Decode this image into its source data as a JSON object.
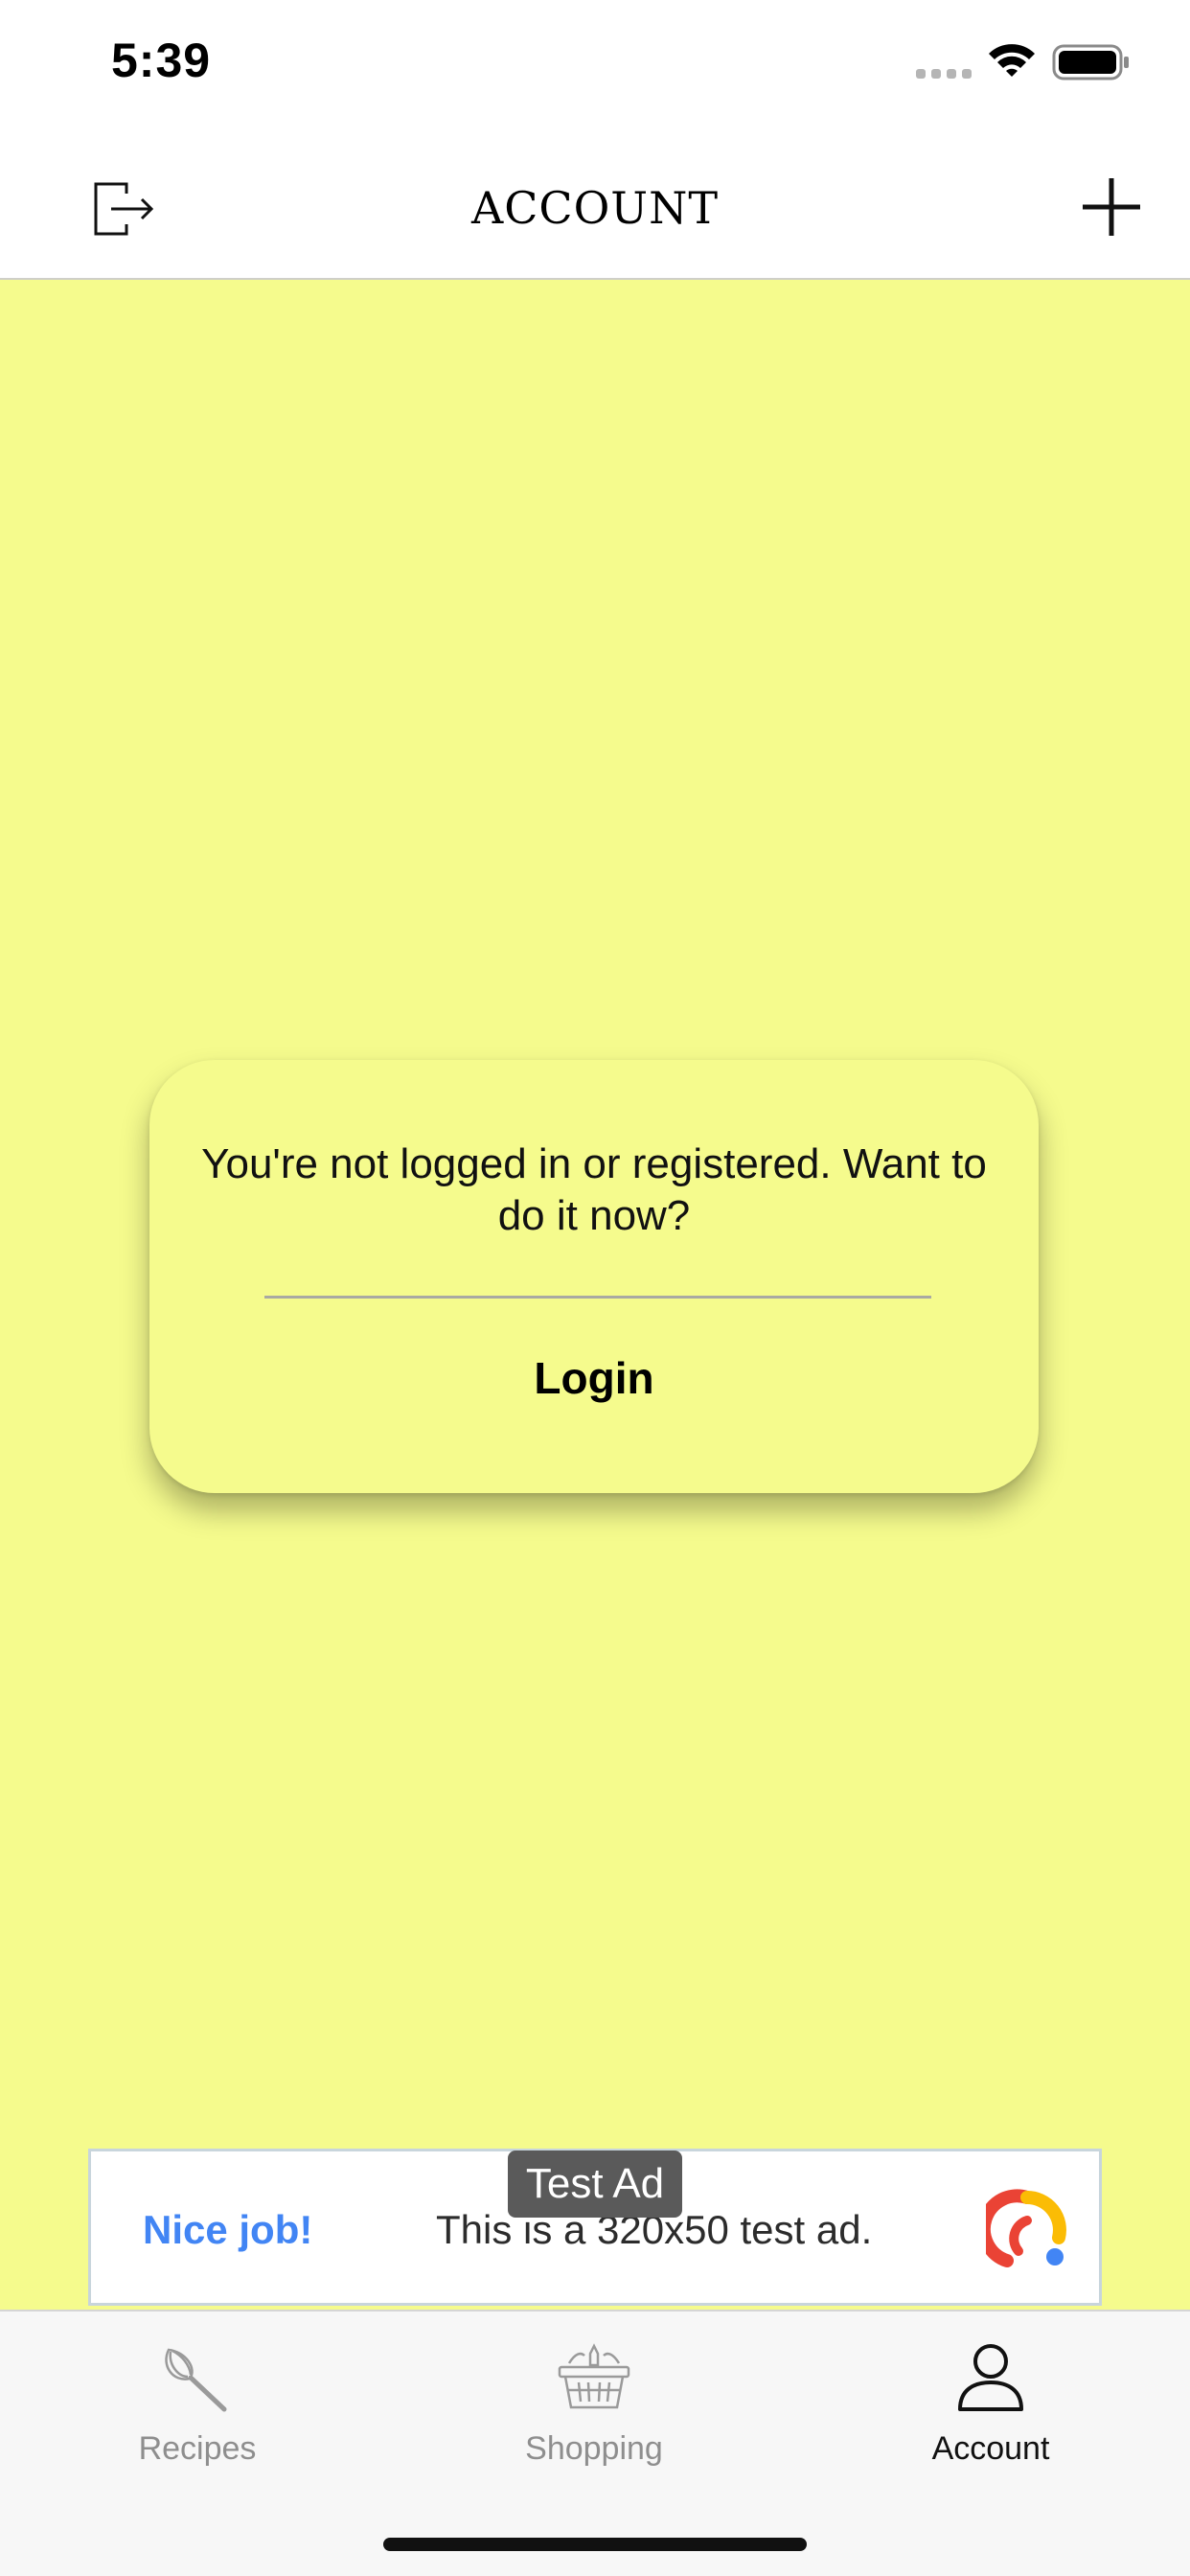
{
  "status_bar": {
    "time": "5:39"
  },
  "nav": {
    "title": "ACCOUNT",
    "left_icon": "logout-icon",
    "right_icon": "plus-icon"
  },
  "theme": {
    "background": "#f5fb8d",
    "ad_headline_color": "#4285f4",
    "ad_tag_background": "#5a5a5a"
  },
  "login_prompt": {
    "message": "You're not logged in or registered. Want to do it now?",
    "button_label": "Login"
  },
  "ad": {
    "tag": "Test Ad",
    "headline": "Nice job!",
    "body": "This is a 320x50 test ad."
  },
  "tab_bar": {
    "tabs": [
      {
        "label": "Recipes",
        "icon": "whisk-icon",
        "active": false
      },
      {
        "label": "Shopping",
        "icon": "basket-icon",
        "active": false
      },
      {
        "label": "Account",
        "icon": "person-icon",
        "active": true
      }
    ]
  }
}
